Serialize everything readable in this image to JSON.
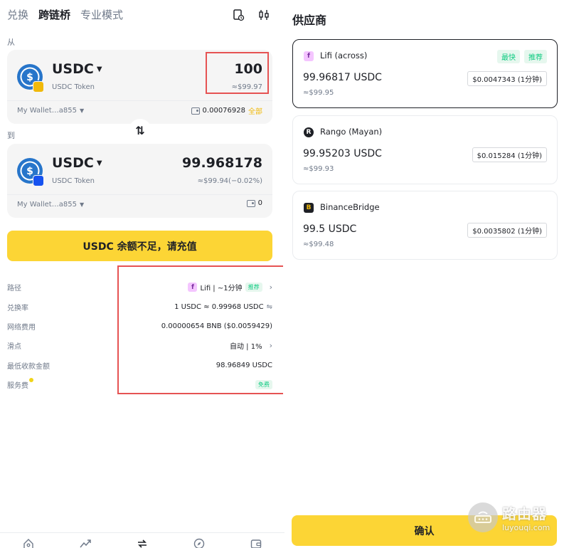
{
  "tabs": [
    {
      "label": "兑换"
    },
    {
      "label": "跨链桥"
    },
    {
      "label": "专业模式"
    }
  ],
  "from_label": "从",
  "to_label": "到",
  "from": {
    "symbol": "USDC",
    "token_name": "USDC Token",
    "amount": "100",
    "amount_usd": "≈$99.97",
    "wallet": "My Wallet…a855",
    "balance": "0.00076928",
    "all_label": "全部"
  },
  "to": {
    "symbol": "USDC",
    "token_name": "USDC Token",
    "amount": "99.968178",
    "amount_usd": "≈$99.94(−0.02%)",
    "wallet": "My Wallet…a855",
    "balance": "0"
  },
  "cta_label": "USDC 余额不足，请充值",
  "details": {
    "route": {
      "label": "路径",
      "value": "Lifi | ~1分钟",
      "tag": "推荐"
    },
    "rate": {
      "label": "兑换率",
      "value": "1 USDC ≈ 0.99968 USDC"
    },
    "network_fee": {
      "label": "网络费用",
      "value": "0.00000654 BNB ($0.0059429)"
    },
    "slippage": {
      "label": "滑点",
      "value": "自动 | 1%"
    },
    "min_received": {
      "label": "最低收款金额",
      "value": "98.96849 USDC"
    },
    "service_fee": {
      "label": "服务费",
      "tag": "免费"
    }
  },
  "providers_title": "供应商",
  "providers": [
    {
      "name": "Lifi (across)",
      "tags": [
        "最快",
        "推荐"
      ],
      "amount": "99.96817 USDC",
      "usd": "≈$99.95",
      "fee": "$0.0047343 (1分钟)",
      "logo_letter": "f"
    },
    {
      "name": "Rango (Mayan)",
      "tags": [],
      "amount": "99.95203 USDC",
      "usd": "≈$99.93",
      "fee": "$0.015284 (1分钟)",
      "logo_letter": "R"
    },
    {
      "name": "BinanceBridge",
      "tags": [],
      "amount": "99.5 USDC",
      "usd": "≈$99.48",
      "fee": "$0.0035802 (1分钟)",
      "logo_letter": "B"
    }
  ],
  "confirm_label": "确认",
  "watermark": {
    "cn": "路由器",
    "en": "luyouqi.com"
  },
  "colors": {
    "accent_yellow": "#fcd535",
    "highlight_red": "#e65353",
    "tag_green": "#0ecb81",
    "usdc_blue": "#2775ca",
    "bnb_yellow": "#f0b90b"
  }
}
